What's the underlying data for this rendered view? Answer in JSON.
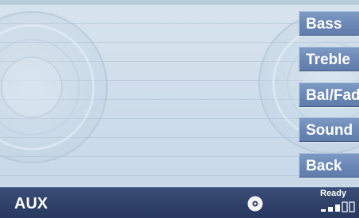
{
  "menu": {
    "items": [
      {
        "label": "Bass"
      },
      {
        "label": "Treble"
      },
      {
        "label": "Bal/Fader"
      },
      {
        "label": "Sound"
      },
      {
        "label": "Back"
      }
    ]
  },
  "status_bar": {
    "source": "AUX",
    "ready": "Ready",
    "cd_icon": "cd-disc-icon",
    "signal_icon": "signal-strength-icon"
  },
  "colors": {
    "background": "#cfdde8",
    "button": "#6b88b6",
    "status_bar": "#2f4068",
    "text": "#ffffff"
  }
}
